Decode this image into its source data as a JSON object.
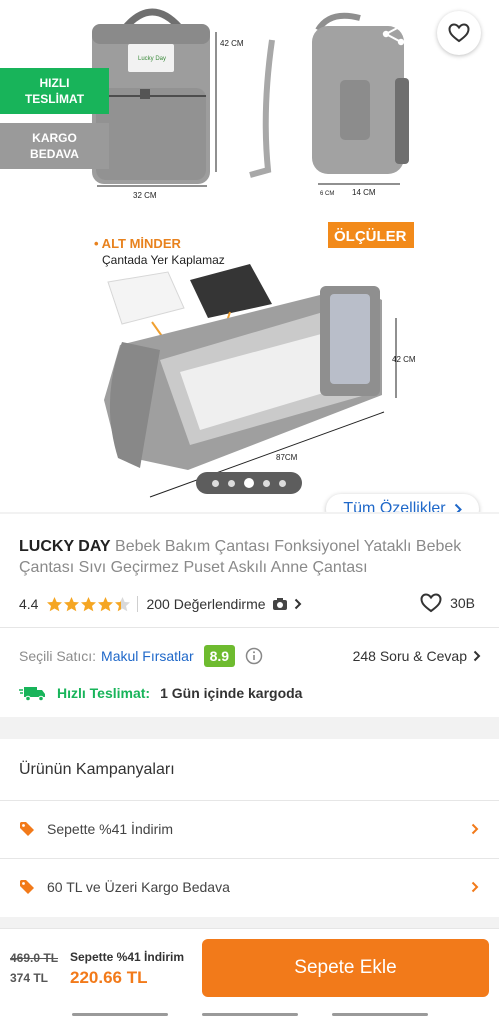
{
  "gallery": {
    "badges": {
      "fast_line1": "HIZLI",
      "fast_line2": "TESLİMAT",
      "cargo_line1": "KARGO",
      "cargo_line2": "BEDAVA"
    },
    "image_text": {
      "dim_42_front": "42 CM",
      "dim_32": "32 CM",
      "dim_6": "6 CM",
      "dim_14": "14 CM",
      "alt_minder": "• ALT MİNDER",
      "space_note": "Çantada Yer Kaplamaz",
      "olculer": "ÖLÇÜLER",
      "dim_42_bed": "42 CM",
      "dim_87": "87CM",
      "bag_logo": "Lucky Day"
    },
    "slides": {
      "count": 5,
      "active_index": 2
    },
    "all_features_label": "Tüm Özellikler"
  },
  "product": {
    "brand": "LUCKY DAY",
    "name": "Bebek Bakım Çantası Fonksiyonel Yataklı Bebek Çantası Sıvı Geçirmez Puset Askılı Anne Çantası",
    "rating": "4.4",
    "rating_value": 4.4,
    "reviews": "200 Değerlendirme",
    "favorites": "30B",
    "seller_label": "Seçili Satıcı:",
    "seller_name": "Makul Fırsatlar",
    "seller_score": "8.9",
    "qa": "248 Soru & Cevap",
    "delivery_label": "Hızlı Teslimat:",
    "delivery_text": "1 Gün içinde kargoda"
  },
  "campaigns": {
    "title": "Ürünün Kampanyaları",
    "items": [
      {
        "label": "Sepette %41 İndirim"
      },
      {
        "label": "60 TL ve Üzeri Kargo Bedava"
      }
    ]
  },
  "cart": {
    "old_price": "469.0 TL",
    "prev_price": "374 TL",
    "promo_label": "Sepette %41 İndirim",
    "promo_price": "220.66 TL",
    "add_button": "Sepete Ekle"
  },
  "colors": {
    "brand_orange": "#f27a1a",
    "link_blue": "#1f68c9",
    "fast_green": "#18b45a",
    "score_green": "#6ebb2f",
    "star_orange": "#f5a623"
  }
}
